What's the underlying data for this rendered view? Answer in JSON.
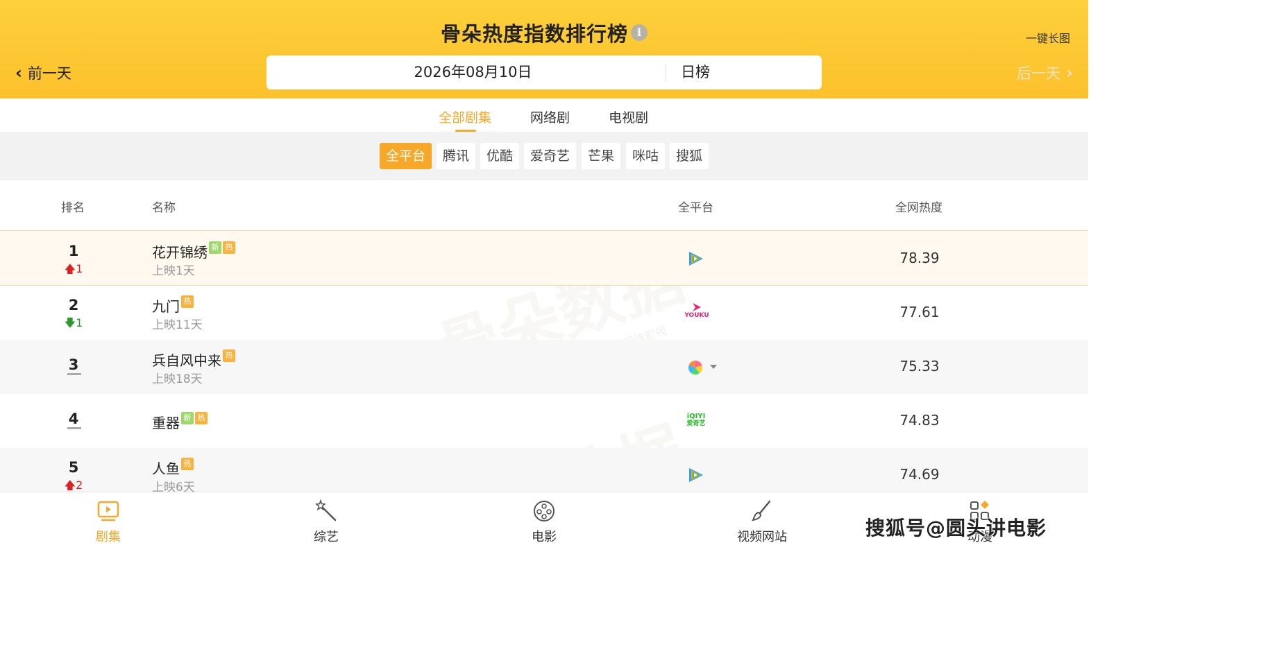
{
  "header": {
    "title": "骨朵热度指数排行榜",
    "info_icon": "i",
    "long_image": "一键长图",
    "prev_day": "前一天",
    "next_day": "后一天",
    "date": "2026年08月10日",
    "mode": "日榜"
  },
  "category_tabs": [
    {
      "label": "全部剧集",
      "active": true
    },
    {
      "label": "网络剧",
      "active": false
    },
    {
      "label": "电视剧",
      "active": false
    }
  ],
  "platforms": [
    {
      "label": "全平台",
      "active": true
    },
    {
      "label": "腾讯",
      "active": false
    },
    {
      "label": "优酷",
      "active": false
    },
    {
      "label": "爱奇艺",
      "active": false
    },
    {
      "label": "芒果",
      "active": false
    },
    {
      "label": "咪咕",
      "active": false
    },
    {
      "label": "搜狐",
      "active": false
    }
  ],
  "table": {
    "headers": {
      "rank": "排名",
      "name": "名称",
      "platform": "全平台",
      "heat": "全网热度"
    },
    "rows": [
      {
        "rank": "1",
        "change": "1",
        "change_dir": "up",
        "name": "花开锦绣",
        "badges": [
          "新",
          "热"
        ],
        "days": "上映1天",
        "platform": "tencent-video-icon",
        "heat": "78.39"
      },
      {
        "rank": "2",
        "change": "1",
        "change_dir": "down",
        "name": "九门",
        "badges": [
          "热"
        ],
        "days": "上映11天",
        "platform": "youku-icon",
        "heat": "77.61"
      },
      {
        "rank": "3",
        "change": "",
        "change_dir": "none",
        "name": "兵自风中来",
        "badges": [
          "热"
        ],
        "days": "上映18天",
        "platform": "multi-platform-icon",
        "heat": "75.33"
      },
      {
        "rank": "4",
        "change": "",
        "change_dir": "none",
        "name": "重器",
        "badges": [
          "新",
          "热"
        ],
        "days": "",
        "platform": "iqiyi-icon",
        "heat": "74.83"
      },
      {
        "rank": "5",
        "change": "2",
        "change_dir": "up",
        "name": "人鱼",
        "badges": [
          "热"
        ],
        "days": "上映6天",
        "platform": "tencent-video-icon",
        "heat": "74.69"
      }
    ]
  },
  "iqiyi_text": {
    "top": "iQIYI",
    "bottom": "爱奇艺"
  },
  "youku_text": "YOUKU",
  "watermark": {
    "text": "骨朵数据",
    "sub": "@骨朵网络影视"
  },
  "bottom_nav": [
    {
      "label": "剧集",
      "icon": "tv-play-icon",
      "active": true
    },
    {
      "label": "综艺",
      "icon": "magic-wand-icon",
      "active": false
    },
    {
      "label": "电影",
      "icon": "film-reel-icon",
      "active": false
    },
    {
      "label": "视频网站",
      "icon": "brush-icon",
      "active": false
    },
    {
      "label": "动漫",
      "icon": "apps-icon",
      "active": false
    }
  ],
  "overlay_caption": "搜狐号@圆头讲电影",
  "colors": {
    "accent": "#f7a828",
    "header_top": "#fdd03a",
    "up": "#e02020",
    "down": "#2a9a2a"
  }
}
